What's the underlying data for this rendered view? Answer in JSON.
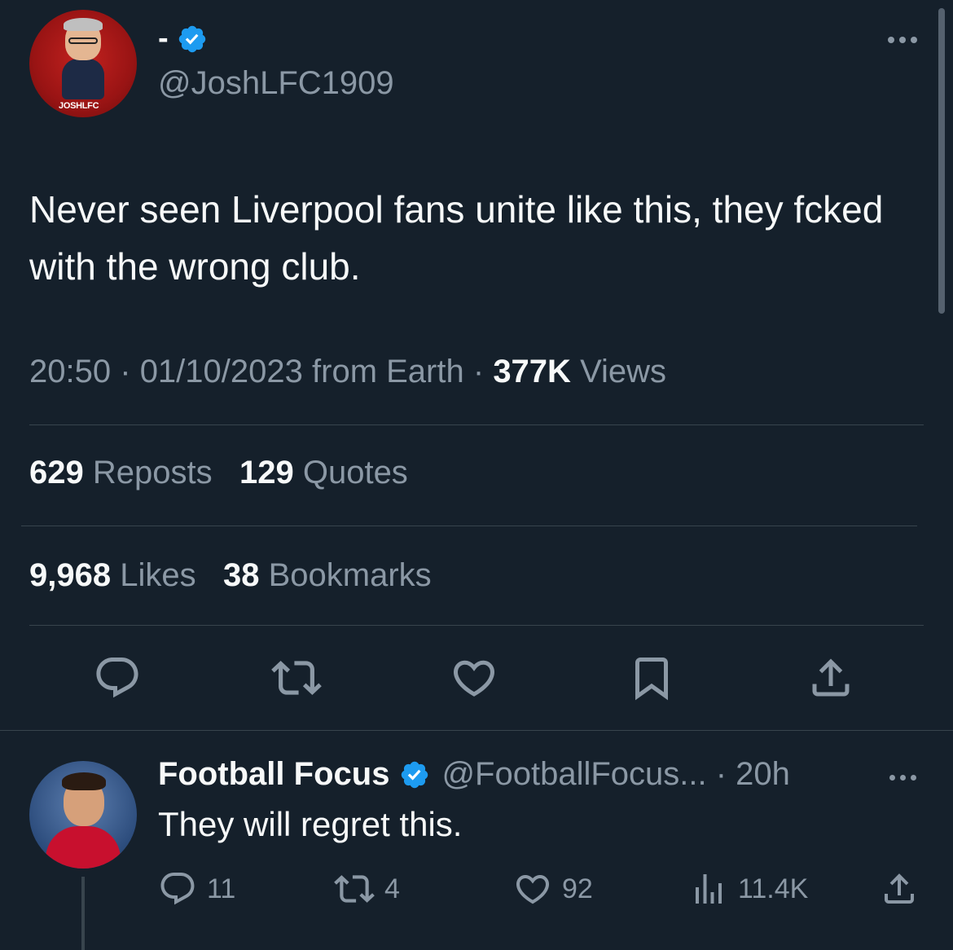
{
  "tweet": {
    "display_name": "-",
    "handle": "@JoshLFC1909",
    "avatar_badge": "JOSHLFC",
    "text": "Never seen Liverpool fans unite like this, they fcked with the wrong club.",
    "time": "20:50",
    "date": "01/10/2023",
    "source": "from Earth",
    "views_count": "377K",
    "views_label": "Views",
    "separator": "·",
    "reposts_count": "629",
    "reposts_label": "Reposts",
    "quotes_count": "129",
    "quotes_label": "Quotes",
    "likes_count": "9,968",
    "likes_label": "Likes",
    "bookmarks_count": "38",
    "bookmarks_label": "Bookmarks"
  },
  "actions": [
    "reply-icon",
    "repost-icon",
    "like-icon",
    "bookmark-icon",
    "share-icon"
  ],
  "reply": {
    "display_name": "Football Focus",
    "handle_time": "@FootballFocus... · 20h",
    "text": "They will regret this.",
    "replies": "11",
    "reposts": "4",
    "likes": "92",
    "views": "11.4K"
  },
  "colors": {
    "background": "#15202b",
    "text_primary": "#f7f9f9",
    "text_secondary": "#8b98a5",
    "verified": "#1d9bf0",
    "divider": "#38444d"
  }
}
